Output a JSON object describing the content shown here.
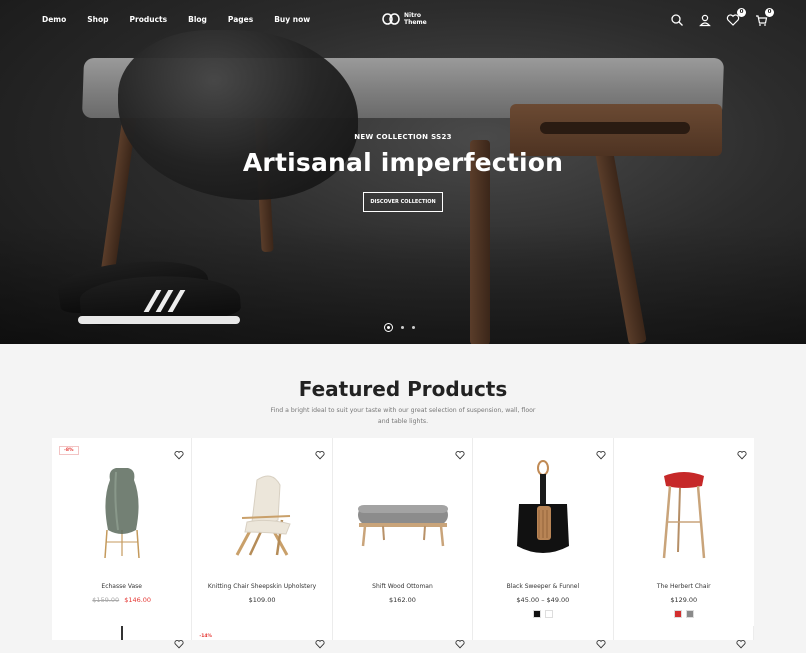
{
  "nav": {
    "links": [
      "Demo",
      "Shop",
      "Products",
      "Blog",
      "Pages",
      "Buy now"
    ],
    "logo_line1": "Nitro",
    "logo_line2": "Theme",
    "wishlist_count": "0",
    "cart_count": "0"
  },
  "hero": {
    "kicker": "NEW COLLECTION SS23",
    "title": "Artisanal imperfection",
    "button": "DISCOVER COLLECTION",
    "slides": 3,
    "active_slide": 1
  },
  "featured": {
    "title": "Featured Products",
    "subtitle": "Find a bright ideal to suit your taste with our great selection of suspension, wall, floor and table lights.",
    "products": [
      {
        "name": "Echasse Vase",
        "old_price": "$159.00",
        "price": "$146.00",
        "badge": "-8%",
        "icon": "vase-image"
      },
      {
        "name": "Knitting Chair Sheepskin Upholstery",
        "price": "$109.00",
        "icon": "chair-image"
      },
      {
        "name": "Shift Wood Ottoman",
        "price": "$162.00",
        "icon": "ottoman-image"
      },
      {
        "name": "Black Sweeper & Funnel",
        "price": "$45.00 – $49.00",
        "icon": "sweeper-image",
        "swatches": [
          "#111111",
          "#ffffff"
        ]
      },
      {
        "name": "The Herbert Chair",
        "price": "$129.00",
        "icon": "stool-image",
        "swatches": [
          "#d32f2f",
          "#8a8a8a"
        ]
      }
    ],
    "row2_badge": "-14%"
  }
}
